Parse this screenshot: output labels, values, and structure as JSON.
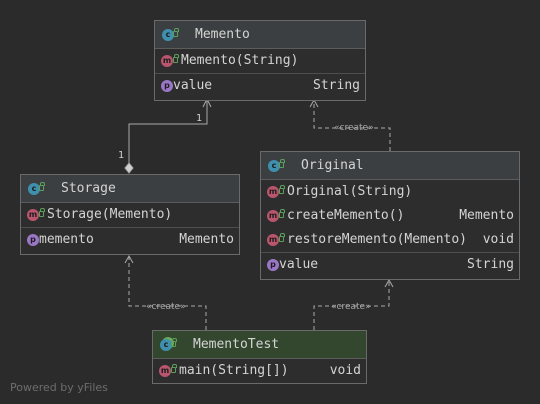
{
  "colors": {
    "background": "#2b2b2b",
    "edge": "#a9a9a9",
    "test_header": "#33472f"
  },
  "nodes": {
    "memento": {
      "name": "Memento",
      "constructor": "Memento(String)",
      "field": {
        "name": "value",
        "type": "String"
      }
    },
    "storage": {
      "name": "Storage",
      "constructor": "Storage(Memento)",
      "field": {
        "name": "memento",
        "type": "Memento"
      }
    },
    "original": {
      "name": "Original",
      "constructor": "Original(String)",
      "methods": [
        {
          "name": "createMemento()",
          "type": "Memento"
        },
        {
          "name": "restoreMemento(Memento)",
          "type": "void"
        }
      ],
      "field": {
        "name": "value",
        "type": "String"
      }
    },
    "memento_test": {
      "name": "MementoTest",
      "method": {
        "name": "main(String[])",
        "type": "void"
      }
    }
  },
  "edges": {
    "create_label": "«create»",
    "mult_memento": "1",
    "mult_storage": "1"
  },
  "footer": "Powered by yFiles"
}
